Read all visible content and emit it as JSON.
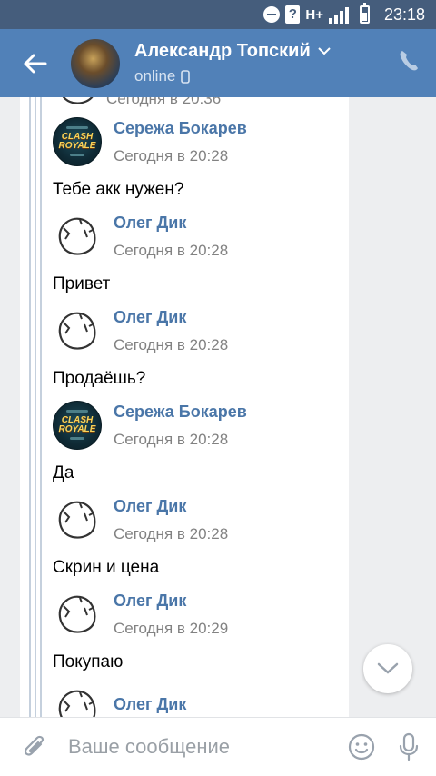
{
  "status_bar": {
    "network": "H+",
    "time": "23:18"
  },
  "header": {
    "contact_name": "Александр Топский",
    "status": "online",
    "icons": {
      "back": "arrow-left-icon",
      "dropdown": "chevron-down-icon",
      "device": "mobile-icon",
      "call": "phone-icon"
    }
  },
  "chat": {
    "partial_time": "Сегодня в 20:36",
    "messages": [
      {
        "author": "Сережа Бокарев",
        "time": "Сегодня в 20:28",
        "text": "Тебе акк нужен?",
        "avatar": "clash-royale"
      },
      {
        "author": "Олег Дик",
        "time": "Сегодня в 20:28",
        "text": "Привет",
        "avatar": "egg"
      },
      {
        "author": "Олег Дик",
        "time": "Сегодня в 20:28",
        "text": "Продаёшь?",
        "avatar": "egg"
      },
      {
        "author": "Сережа Бокарев",
        "time": "Сегодня в 20:28",
        "text": "Да",
        "avatar": "clash-royale"
      },
      {
        "author": "Олег Дик",
        "time": "Сегодня в 20:28",
        "text": "Скрин и цена",
        "avatar": "egg"
      },
      {
        "author": "Олег Дик",
        "time": "Сегодня в 20:29",
        "text": "Покупаю",
        "avatar": "egg"
      },
      {
        "author": "Олег Дик",
        "time": "",
        "text": "",
        "avatar": "egg"
      }
    ]
  },
  "avatar_texts": {
    "clash_royale": "CLASH ROYALE"
  },
  "input": {
    "placeholder": "Ваше сообщение",
    "value": ""
  },
  "colors": {
    "status_bar": "#455d7c",
    "header": "#5181b8",
    "author": "#4a76a8",
    "chat_bg": "#edeef0"
  }
}
